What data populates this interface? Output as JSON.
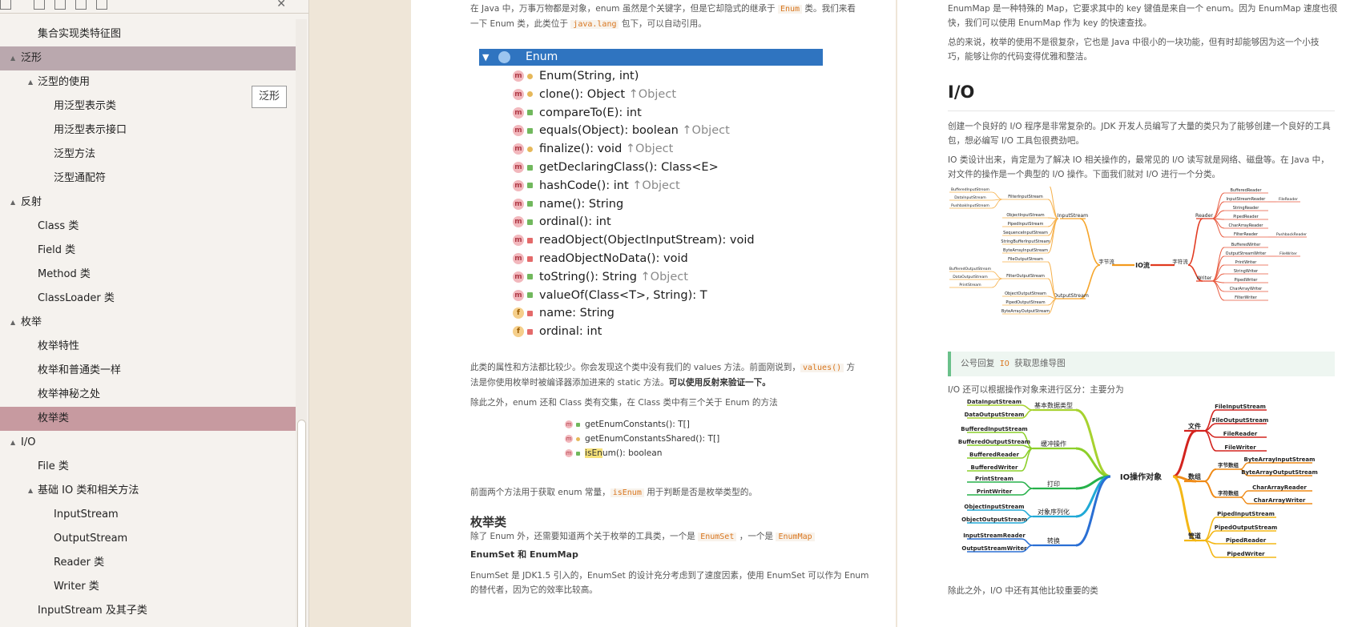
{
  "sidebar": {
    "items": [
      {
        "label": "集合实现类特征图",
        "indent": 2,
        "twisty": "",
        "state": ""
      },
      {
        "label": "泛形",
        "indent": 1,
        "twisty": "▲",
        "state": "gray"
      },
      {
        "label": "泛型的使用",
        "indent": 2,
        "twisty": "▲",
        "state": ""
      },
      {
        "label": "用泛型表示类",
        "indent": 3,
        "twisty": "",
        "state": ""
      },
      {
        "label": "用泛型表示接口",
        "indent": 3,
        "twisty": "",
        "state": ""
      },
      {
        "label": "泛型方法",
        "indent": 3,
        "twisty": "",
        "state": ""
      },
      {
        "label": "泛型通配符",
        "indent": 3,
        "twisty": "",
        "state": ""
      },
      {
        "label": "反射",
        "indent": 1,
        "twisty": "▲",
        "state": ""
      },
      {
        "label": "Class 类",
        "indent": 2,
        "twisty": "",
        "state": ""
      },
      {
        "label": "Field 类",
        "indent": 2,
        "twisty": "",
        "state": ""
      },
      {
        "label": "Method 类",
        "indent": 2,
        "twisty": "",
        "state": ""
      },
      {
        "label": "ClassLoader 类",
        "indent": 2,
        "twisty": "",
        "state": ""
      },
      {
        "label": "枚举",
        "indent": 1,
        "twisty": "▲",
        "state": ""
      },
      {
        "label": "枚举特性",
        "indent": 2,
        "twisty": "",
        "state": ""
      },
      {
        "label": "枚举和普通类一样",
        "indent": 2,
        "twisty": "",
        "state": ""
      },
      {
        "label": "枚举神秘之处",
        "indent": 2,
        "twisty": "",
        "state": ""
      },
      {
        "label": "枚举类",
        "indent": 2,
        "twisty": "",
        "state": "rose"
      },
      {
        "label": "I/O",
        "indent": 1,
        "twisty": "▲",
        "state": ""
      },
      {
        "label": "File 类",
        "indent": 2,
        "twisty": "",
        "state": ""
      },
      {
        "label": "基础 IO 类和相关方法",
        "indent": 2,
        "twisty": "▲",
        "state": ""
      },
      {
        "label": "InputStream",
        "indent": 3,
        "twisty": "",
        "state": ""
      },
      {
        "label": "OutputStream",
        "indent": 3,
        "twisty": "",
        "state": ""
      },
      {
        "label": "Reader 类",
        "indent": 3,
        "twisty": "",
        "state": ""
      },
      {
        "label": "Writer 类",
        "indent": 3,
        "twisty": "",
        "state": ""
      },
      {
        "label": "InputStream 及其子类",
        "indent": 2,
        "twisty": "",
        "state": ""
      }
    ],
    "tooltip": "泛形",
    "toolbar_close": "✕"
  },
  "left_page": {
    "intro": [
      "在 Java 中，万事万物都是对象，enum 虽然是个关键字，但是它却隐式的继承于 ",
      "Enum",
      " 类。我们来看",
      "一下 Enum 类，此类位于 ",
      "java.lang",
      " 包下，可以自动引用。"
    ],
    "structure": {
      "header": "Enum",
      "rows": [
        {
          "kind": "m",
          "vis": "pro",
          "text": "Enum(String, int)",
          "inh": ""
        },
        {
          "kind": "m",
          "vis": "pro",
          "text": "clone(): Object",
          "inh": "↑Object"
        },
        {
          "kind": "m",
          "vis": "pub",
          "text": "compareTo(E): int",
          "inh": ""
        },
        {
          "kind": "m",
          "vis": "pub",
          "text": "equals(Object): boolean",
          "inh": "↑Object"
        },
        {
          "kind": "m",
          "vis": "pro",
          "text": "finalize(): void",
          "inh": "↑Object"
        },
        {
          "kind": "m",
          "vis": "pub",
          "text": "getDeclaringClass(): Class<E>",
          "inh": ""
        },
        {
          "kind": "m",
          "vis": "pub",
          "text": "hashCode(): int",
          "inh": "↑Object"
        },
        {
          "kind": "m",
          "vis": "pub",
          "text": "name(): String",
          "inh": ""
        },
        {
          "kind": "m",
          "vis": "pub",
          "text": "ordinal(): int",
          "inh": ""
        },
        {
          "kind": "m",
          "vis": "pri",
          "text": "readObject(ObjectInputStream): void",
          "inh": ""
        },
        {
          "kind": "m",
          "vis": "pri",
          "text": "readObjectNoData(): void",
          "inh": ""
        },
        {
          "kind": "m",
          "vis": "pub",
          "text": "toString(): String",
          "inh": "↑Object"
        },
        {
          "kind": "m",
          "vis": "pub",
          "text": "valueOf(Class<T>, String): T",
          "inh": ""
        },
        {
          "kind": "f",
          "vis": "pri",
          "text": "name: String",
          "inh": ""
        },
        {
          "kind": "f",
          "vis": "pri",
          "text": "ordinal: int",
          "inh": ""
        }
      ]
    },
    "para1": [
      "此类的属性和方法都比较少。你会发现这个类中没有我们的 values 方法。前面刚说到，",
      "values()",
      " 方",
      "法是你使用枚举时被编译器添加进来的 static 方法。",
      "可以使用反射来验证一下。"
    ],
    "para2": "除此之外，enum 还和 Class 类有交集，在 Class 类中有三个关于 Enum 的方法",
    "class_methods": [
      {
        "vis": "pub",
        "pre": "",
        "hl": "",
        "text": "getEnumConstants(): T[]"
      },
      {
        "vis": "pro",
        "pre": "",
        "hl": "",
        "text": "getEnumConstantsShared(): T[]"
      },
      {
        "vis": "pub",
        "pre": "",
        "hl": "isEn",
        "text": "um(): boolean"
      }
    ],
    "para3": [
      "前面两个方法用于获取 enum 常量，",
      "isEnum",
      " 用于判断是否是枚举类型的。"
    ],
    "h_enum_class": "枚举类",
    "para4": [
      "除了 Enum 外，还需要知道两个关于枚举的工具类，一个是 ",
      "EnumSet",
      " ，一个是 ",
      "EnumMap"
    ],
    "h_small": "EnumSet 和 EnumMap",
    "para5": [
      "EnumSet 是 JDK1.5 引入的，EnumSet 的设计充分考虑到了速度因素，使用 EnumSet 可以作为 Enum",
      "的替代者，因为它的效率比较高。"
    ]
  },
  "right_page": {
    "p1": [
      "EnumMap 是一种特殊的 Map，它要求其中的 key 键值是来自一个 enum。因为 EnumMap 速度也很",
      "快，我们可以使用 EnumMap 作为 key 的快速查找。"
    ],
    "p2": [
      "总的来说，枚举的使用不是很复杂，它也是 Java 中很小的一块功能，但有时却能够因为这一个小技",
      "巧，能够让你的代码变得优雅和整洁。"
    ],
    "h_io": "I/O",
    "p3": [
      "创建一个良好的 I/O 程序是非常复杂的。JDK 开发人员编写了大量的类只为了能够创建一个良好的工具",
      "包，想必编写 I/O 工具包很费劲吧。"
    ],
    "p4": [
      "IO 类设计出来，肯定是为了解决 IO 相关操作的，最常见的 I/O 读写就是网络、磁盘等。在 Java 中，",
      "对文件的操作是一个典型的 I/O 操作。下面我们就对 I/O 进行一个分类。"
    ],
    "mindmap1": {
      "center": "IO流",
      "byte": "字节流",
      "char": "字符流",
      "input": "InputStream",
      "output": "OutputStream",
      "reader": "Reader",
      "writer": "Writer",
      "input_children": [
        "FileInputStream",
        "FilterInputStream",
        "ObjectInputStream",
        "PipedInputStream",
        "SequenceInputStream",
        "StringBufferInputStream",
        "ByteArrayInputStream"
      ],
      "filter_in": [
        "BufferedInputStream",
        "DataInputStream",
        "PushbakInputStream"
      ],
      "output_children": [
        "FileOutputStream",
        "FilterOutputStream",
        "ObjectOutputStream",
        "PipedOutputStream",
        "ByteArrayOutputStream"
      ],
      "filter_out": [
        "BufferedOutputStream",
        "DataOutputStream",
        "PrintStream"
      ],
      "reader_children": [
        "BufferedReader",
        "InputStreamReader",
        "StringReader",
        "PipedReader",
        "CharArrayReader",
        "FilterReader"
      ],
      "reader_sub": [
        "FileReader",
        "PushbackReader"
      ],
      "writer_children": [
        "BufferedWriter",
        "OutputStreamWriter",
        "PrintWriter",
        "StringWriter",
        "PipedWriter",
        "CharArrayWriter",
        "FilterWriter"
      ],
      "writer_sub": [
        "FileWriter"
      ]
    },
    "callout": [
      "公号回复 ",
      "IO",
      " 获取思维导图"
    ],
    "p5": "I/O 还可以根据操作对象来进行区分：主要分为",
    "mindmap2": {
      "center": "IO操作对象",
      "groups": [
        {
          "label": "基本数据类型",
          "color": "#a7d22f",
          "leaves": [
            "DataInputStream",
            "DataOutputStream"
          ]
        },
        {
          "label": "缓冲操作",
          "color": "#8ccf2a",
          "leaves": [
            "BufferedInputStream",
            "BufferedOutputStream",
            "BufferedReader",
            "BufferedWriter"
          ]
        },
        {
          "label": "打印",
          "color": "#26b14a",
          "leaves": [
            "PrintStream",
            "PrintWriter"
          ]
        },
        {
          "label": "对象序列化",
          "color": "#20a9d6",
          "leaves": [
            "ObjectInputStream",
            "ObjectOutputStream"
          ]
        },
        {
          "label": "转换",
          "color": "#2a6fd4",
          "leaves": [
            "InputStreamReader",
            "OutputStreamWriter"
          ]
        }
      ],
      "right_groups": [
        {
          "label": "文件",
          "color": "#d3231e",
          "leaves": [
            "FileInputStream",
            "FileOutputStream",
            "FileReader",
            "FileWriter"
          ]
        },
        {
          "label": "数组",
          "color": "#ef8a16",
          "sub": [
            {
              "label": "字节数组",
              "leaves": [
                "ByteArrayInputStream",
                "ByteArrayOutputStream"
              ]
            },
            {
              "label": "字符数组",
              "leaves": [
                "CharArrayReader",
                "CharArrayWriter"
              ]
            }
          ]
        },
        {
          "label": "管道",
          "color": "#f4b716",
          "leaves": [
            "PipedInputStream",
            "PipedOutputStream",
            "PipedReader",
            "PipedWriter"
          ]
        }
      ]
    },
    "p6": "除此之外，I/O 中还有其他比较重要的类"
  }
}
